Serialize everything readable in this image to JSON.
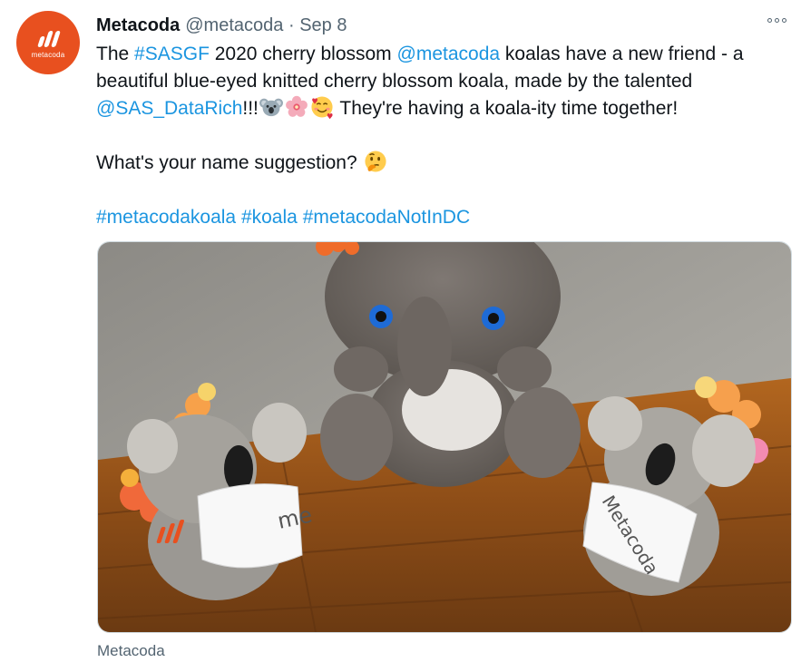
{
  "tweet": {
    "author": {
      "name": "Metacoda",
      "handle": "@metacoda",
      "avatar_word": "metacoda"
    },
    "separator": "·",
    "date": "Sep 8",
    "line1": {
      "a": "The ",
      "hashtag1": "#SASGF",
      "b": " 2020 cherry blossom ",
      "mention1": "@metacoda",
      "c": " koalas have a new friend - a"
    },
    "line2": "beautiful blue-eyed knitted cherry blossom koala, made by the talented",
    "line3": {
      "mention2": "@SAS_DataRich",
      "bangs": "!!!",
      "after_emoji": " They're having a koala-ity time together!"
    },
    "line4": "What's your name suggestion? ",
    "hashtags": [
      "#metacodakoala",
      "#koala",
      "#metacodaNotInDC"
    ],
    "emojis": [
      "koala-emoji",
      "cherry-blossom-emoji",
      "smiling-face-with-hearts-emoji",
      "thinking-face-emoji"
    ],
    "image": {
      "shirt_text_left": "me",
      "shirt_text_right": "Metacoda"
    },
    "media_caption": "Metacoda"
  },
  "colors": {
    "link": "#1b95e0",
    "secondary_text": "#536471",
    "brand": "#e8501f"
  }
}
